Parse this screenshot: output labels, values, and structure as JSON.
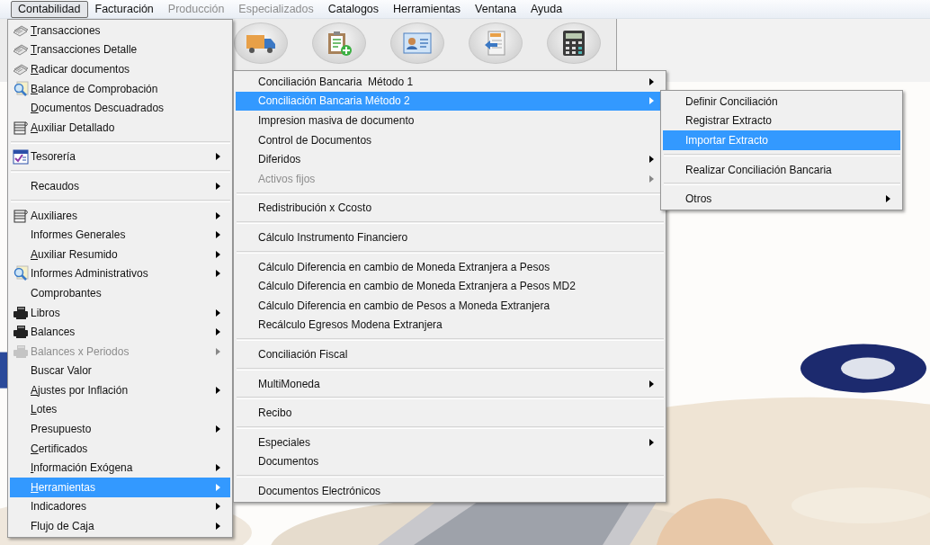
{
  "menubar": [
    {
      "label": "Contabilidad",
      "selected": true,
      "disabled": false
    },
    {
      "label": "Facturación",
      "selected": false,
      "disabled": false
    },
    {
      "label": "Producción",
      "selected": false,
      "disabled": true
    },
    {
      "label": "Especializados",
      "selected": false,
      "disabled": true
    },
    {
      "label": "Catalogos",
      "selected": false,
      "disabled": false
    },
    {
      "label": "Herramientas",
      "selected": false,
      "disabled": false
    },
    {
      "label": "Ventana",
      "selected": false,
      "disabled": false
    },
    {
      "label": "Ayuda",
      "selected": false,
      "disabled": false
    }
  ],
  "menus": [
    {
      "items": [
        {
          "kind": "documents",
          "label": "Transacciones",
          "mnemonic": true,
          "submenu": false,
          "selected": false,
          "disabled": false
        },
        {
          "kind": "documents",
          "label": "Transacciones Detalle",
          "mnemonic": true,
          "submenu": false,
          "selected": false,
          "disabled": false
        },
        {
          "kind": "documents",
          "label": "Radicar documentos",
          "mnemonic": true,
          "submenu": false,
          "selected": false,
          "disabled": false
        },
        {
          "kind": "magnifier",
          "label": "Balance de Comprobación",
          "mnemonic": true,
          "submenu": false,
          "selected": false,
          "disabled": false
        },
        {
          "kind": "item",
          "label": "Documentos Descuadrados",
          "mnemonic": true,
          "submenu": false,
          "selected": false,
          "disabled": false
        },
        {
          "kind": "ledger",
          "label": "Auxiliar Detallado",
          "mnemonic": true,
          "submenu": false,
          "selected": false,
          "disabled": false
        },
        {
          "kind": "separator"
        },
        {
          "kind": "calendar",
          "label": "Tesorería",
          "mnemonic": false,
          "submenu": true,
          "selected": false,
          "disabled": false
        },
        {
          "kind": "separator"
        },
        {
          "kind": "item",
          "label": "Recaudos",
          "mnemonic": false,
          "submenu": true,
          "selected": false,
          "disabled": false
        },
        {
          "kind": "separator"
        },
        {
          "kind": "ledger",
          "label": "Auxiliares",
          "mnemonic": false,
          "submenu": true,
          "selected": false,
          "disabled": false
        },
        {
          "kind": "item",
          "label": "Informes Generales",
          "mnemonic": false,
          "submenu": true,
          "selected": false,
          "disabled": false
        },
        {
          "kind": "item",
          "label": "Auxiliar Resumido",
          "mnemonic": true,
          "submenu": true,
          "selected": false,
          "disabled": false
        },
        {
          "kind": "magnifier",
          "label": "Informes Administrativos",
          "mnemonic": false,
          "submenu": true,
          "selected": false,
          "disabled": false
        },
        {
          "kind": "item",
          "label": "Comprobantes",
          "mnemonic": false,
          "submenu": false,
          "selected": false,
          "disabled": false
        },
        {
          "kind": "printer",
          "label": "Libros",
          "mnemonic": false,
          "submenu": true,
          "selected": false,
          "disabled": false
        },
        {
          "kind": "printer",
          "label": "Balances",
          "mnemonic": false,
          "submenu": true,
          "selected": false,
          "disabled": false
        },
        {
          "kind": "printer",
          "label": "Balances x Periodos",
          "mnemonic": false,
          "submenu": true,
          "selected": false,
          "disabled": true
        },
        {
          "kind": "item",
          "label": "Buscar Valor",
          "mnemonic": false,
          "submenu": false,
          "selected": false,
          "disabled": false
        },
        {
          "kind": "item",
          "label": "Ajustes por Inflación",
          "mnemonic": true,
          "submenu": true,
          "selected": false,
          "disabled": false
        },
        {
          "kind": "item",
          "label": "Lotes",
          "mnemonic": true,
          "submenu": false,
          "selected": false,
          "disabled": false
        },
        {
          "kind": "item",
          "label": "Presupuesto",
          "mnemonic": false,
          "submenu": true,
          "selected": false,
          "disabled": false
        },
        {
          "kind": "item",
          "label": "Certificados",
          "mnemonic": true,
          "submenu": false,
          "selected": false,
          "disabled": false
        },
        {
          "kind": "item",
          "label": "Información Exógena",
          "mnemonic": true,
          "submenu": true,
          "selected": false,
          "disabled": false
        },
        {
          "kind": "item",
          "label": "Herramientas",
          "mnemonic": true,
          "submenu": true,
          "selected": true,
          "disabled": false
        },
        {
          "kind": "item",
          "label": "Indicadores",
          "mnemonic": false,
          "submenu": true,
          "selected": false,
          "disabled": false
        },
        {
          "kind": "item",
          "label": "Flujo de Caja",
          "mnemonic": false,
          "submenu": true,
          "selected": false,
          "disabled": false
        }
      ]
    },
    {
      "items": [
        {
          "kind": "item",
          "label": "Conciliación Bancaria  Método 1",
          "submenu": true,
          "selected": false,
          "disabled": false
        },
        {
          "kind": "item",
          "label": "Conciliación Bancaria Método 2",
          "submenu": true,
          "selected": true,
          "disabled": false
        },
        {
          "kind": "item",
          "label": "Impresion masiva de documento",
          "submenu": false,
          "selected": false,
          "disabled": false
        },
        {
          "kind": "item",
          "label": "Control de Documentos",
          "submenu": false,
          "selected": false,
          "disabled": false
        },
        {
          "kind": "item",
          "label": "Diferidos",
          "submenu": true,
          "selected": false,
          "disabled": false
        },
        {
          "kind": "item",
          "label": "Activos fijos",
          "submenu": true,
          "selected": false,
          "disabled": true
        },
        {
          "kind": "separator"
        },
        {
          "kind": "item",
          "label": "Redistribución x Ccosto",
          "submenu": false,
          "selected": false,
          "disabled": false
        },
        {
          "kind": "separator"
        },
        {
          "kind": "item",
          "label": "Cálculo Instrumento Financiero",
          "submenu": false,
          "selected": false,
          "disabled": false
        },
        {
          "kind": "separator"
        },
        {
          "kind": "item",
          "label": "Cálculo Diferencia en cambio de Moneda Extranjera a Pesos",
          "submenu": false,
          "selected": false,
          "disabled": false
        },
        {
          "kind": "item",
          "label": "Cálculo Diferencia en cambio de Moneda Extranjera a Pesos MD2",
          "submenu": false,
          "selected": false,
          "disabled": false
        },
        {
          "kind": "item",
          "label": "Cálculo Diferencia en cambio de Pesos a Moneda Extranjera",
          "submenu": false,
          "selected": false,
          "disabled": false
        },
        {
          "kind": "item",
          "label": "Recálculo Egresos Modena Extranjera",
          "submenu": false,
          "selected": false,
          "disabled": false
        },
        {
          "kind": "separator"
        },
        {
          "kind": "item",
          "label": "Conciliación Fiscal",
          "submenu": false,
          "selected": false,
          "disabled": false
        },
        {
          "kind": "separator"
        },
        {
          "kind": "item",
          "label": "MultiMoneda",
          "submenu": true,
          "selected": false,
          "disabled": false
        },
        {
          "kind": "separator"
        },
        {
          "kind": "item",
          "label": "Recibo",
          "submenu": false,
          "selected": false,
          "disabled": false
        },
        {
          "kind": "separator"
        },
        {
          "kind": "item",
          "label": "Especiales",
          "submenu": true,
          "selected": false,
          "disabled": false
        },
        {
          "kind": "item",
          "label": "Documentos",
          "submenu": false,
          "selected": false,
          "disabled": false
        },
        {
          "kind": "separator"
        },
        {
          "kind": "item",
          "label": "Documentos Electrónicos",
          "submenu": false,
          "selected": false,
          "disabled": false
        }
      ]
    },
    {
      "items": [
        {
          "kind": "item",
          "label": "Definir Conciliación",
          "submenu": false,
          "selected": false,
          "disabled": false
        },
        {
          "kind": "item",
          "label": "Registrar Extracto",
          "submenu": false,
          "selected": false,
          "disabled": false
        },
        {
          "kind": "item",
          "label": "Importar Extracto",
          "submenu": false,
          "selected": true,
          "disabled": false
        },
        {
          "kind": "separator"
        },
        {
          "kind": "item",
          "label": "Realizar Conciliación Bancaria",
          "submenu": false,
          "selected": false,
          "disabled": false
        },
        {
          "kind": "separator"
        },
        {
          "kind": "item",
          "label": "Otros",
          "submenu": true,
          "selected": false,
          "disabled": false
        }
      ]
    }
  ]
}
